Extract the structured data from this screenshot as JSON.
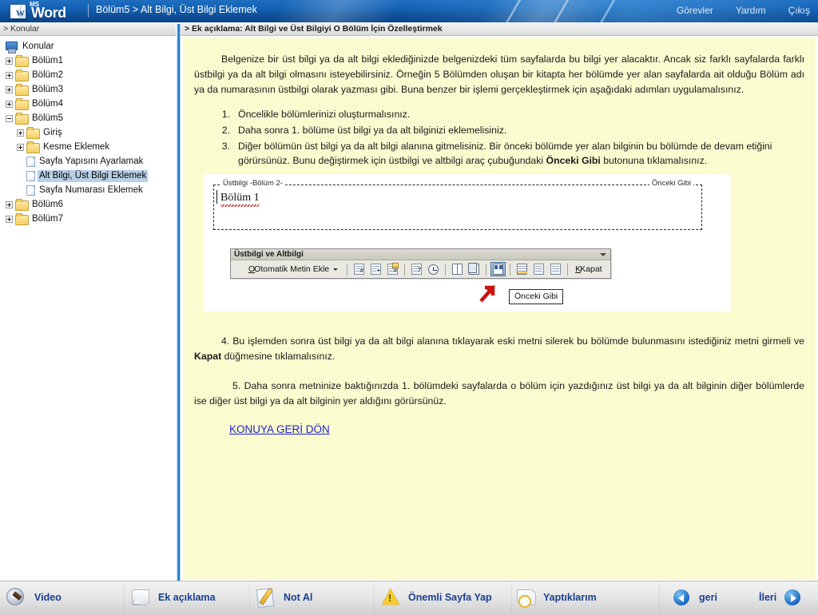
{
  "header": {
    "logo_ms": "MS",
    "logo_word": "Word",
    "breadcrumb": "Bölüm5 > Alt Bilgi, Üst Bilgi Eklemek",
    "nav": [
      {
        "label": "Görevler"
      },
      {
        "label": "Yardım"
      },
      {
        "label": "Çıkış"
      }
    ]
  },
  "subheader": {
    "left": "> Konular",
    "right": "> Ek açıklama: Alt Bilgi ve Üst Bilgiyi O Bölüm İçin Özelleştirmek"
  },
  "sidebar": {
    "root": "Konular",
    "items": [
      {
        "label": "Bölüm1",
        "type": "folder",
        "level": 0,
        "expander": "plus"
      },
      {
        "label": "Bölüm2",
        "type": "folder",
        "level": 0,
        "expander": "plus"
      },
      {
        "label": "Bölüm3",
        "type": "folder",
        "level": 0,
        "expander": "plus"
      },
      {
        "label": "Bölüm4",
        "type": "folder",
        "level": 0,
        "expander": "plus"
      },
      {
        "label": "Bölüm5",
        "type": "folder",
        "level": 0,
        "expander": "minus"
      },
      {
        "label": "Giriş",
        "type": "folder",
        "level": 1,
        "expander": "plus"
      },
      {
        "label": "Kesme Eklemek",
        "type": "folder",
        "level": 1,
        "expander": "plus"
      },
      {
        "label": "Sayfa Yapısını Ayarlamak",
        "type": "page",
        "level": 1,
        "expander": "none"
      },
      {
        "label": "Alt Bilgi, Üst Bilgi Eklemek",
        "type": "page",
        "level": 1,
        "expander": "none",
        "selected": true
      },
      {
        "label": "Sayfa Numarası Eklemek",
        "type": "page",
        "level": 1,
        "expander": "none"
      },
      {
        "label": "Bölüm6",
        "type": "folder",
        "level": 0,
        "expander": "plus"
      },
      {
        "label": "Bölüm7",
        "type": "folder",
        "level": 0,
        "expander": "plus"
      }
    ]
  },
  "content": {
    "paragraph1": "Belgenize bir üst bilgi ya da alt bilgi eklediğinizde belgenizdeki tüm sayfalarda bu bilgi yer alacaktır. Ancak siz farklı sayfalarda farklı üstbilgi ya da alt bilgi olmasını isteyebilirsiniz. Örneğin 5 Bölümden oluşan bir kitapta her bölümde yer alan sayfalarda ait olduğu Bölüm adı ya da numarasının üstbilgi olarak yazması gibi. Buna benzer bir işlemi gerçekleştirmek için aşağıdaki adımları uygulamalısınız.",
    "steps": [
      {
        "num": "1.",
        "text": "Öncelikle bölümlerinizi oluşturmalısınız."
      },
      {
        "num": "2.",
        "text": "Daha sonra 1. bölüme üst bilgi ya da alt bilginizi eklemelisiniz."
      },
      {
        "num": "3.",
        "text_before": "Diğer bölümün üst bilgi ya da alt bilgi alanına gitmelisiniz. Bir önceki bölümde yer alan bilginin bu bölümde de devam etiğini görürsünüz. Bunu değiştirmek için üstbilgi ve altbilgi araç çubuğundaki ",
        "bold": "Önceki Gibi",
        "text_after": " butonuna tıklamalısınız."
      }
    ],
    "screenshot": {
      "header_tag_left": "Üstbilgi -Bölüm 2-",
      "header_tag_right": "Önceki Gibi",
      "header_text": "Bölüm 1",
      "toolbar": {
        "title": "Üstbilgi ve Altbilgi",
        "autotext_label": "Otomatik Metin Ekle",
        "close_label": "Kapat",
        "buttons": [
          {
            "name": "insert-page-number-icon",
            "tip": "Sayfa Numarası Ekle"
          },
          {
            "name": "insert-number-of-pages-icon",
            "tip": "Sayfa Sayısı Ekle"
          },
          {
            "name": "format-page-number-icon",
            "tip": "Sayfa Numarası Biçimlendir"
          },
          {
            "name": "insert-date-icon",
            "tip": "Tarih Ekle"
          },
          {
            "name": "insert-time-icon",
            "tip": "Saat Ekle"
          },
          {
            "name": "page-setup-icon",
            "tip": "Sayfa Yapısı"
          },
          {
            "name": "show-hide-document-text-icon",
            "tip": "Belge Metnini Göster/Gizle"
          },
          {
            "name": "same-as-previous-icon",
            "tip": "Önceki Gibi",
            "active": true
          },
          {
            "name": "switch-header-footer-icon",
            "tip": "Üstbilgi/Altbilgi Arasında Geçiş"
          },
          {
            "name": "show-previous-icon",
            "tip": "Öncekini Göster"
          },
          {
            "name": "show-next-icon",
            "tip": "Sonrakini Göster"
          }
        ]
      },
      "callout_button": "Önceki Gibi"
    },
    "paragraph4": "4. Bu işlemden sonra üst bilgi ya da alt bilgi alanına tıklayarak eski metni silerek bu bölümde bulunmasını istediğiniz metni girmeli ve ",
    "paragraph4_bold": "Kapat",
    "paragraph4_after": " düğmesine tıklamalısınız.",
    "paragraph5": "5. Daha sonra metninize baktığınızda 1. bölümdeki sayfalarda o bölüm için yazdığınız üst bilgi ya da alt bilginin diğer bölümlerde ise diğer üst bilgi ya da alt bilginin yer aldığını görürsünüz.",
    "back_link": "KONUYA GERİ DÖN"
  },
  "bottombar": {
    "buttons": [
      {
        "label": "Video",
        "icon": "video-icon"
      },
      {
        "label": "Ek açıklama",
        "icon": "annotation-icon"
      },
      {
        "label": "Not Al",
        "icon": "take-note-icon"
      },
      {
        "label": "Önemli Sayfa Yap",
        "icon": "warning-icon"
      },
      {
        "label": "Yaptıklarım",
        "icon": "history-icon"
      },
      {
        "label": "geri",
        "icon": "back-arrow-icon"
      },
      {
        "label": "İleri",
        "icon": "forward-arrow-icon"
      }
    ]
  },
  "colors": {
    "header_blue": "#1562b4",
    "content_yellow": "#fbfbd0",
    "link_blue": "#2222cc",
    "selection_blue": "#b8cfe6",
    "accent_red": "#cc1111"
  }
}
